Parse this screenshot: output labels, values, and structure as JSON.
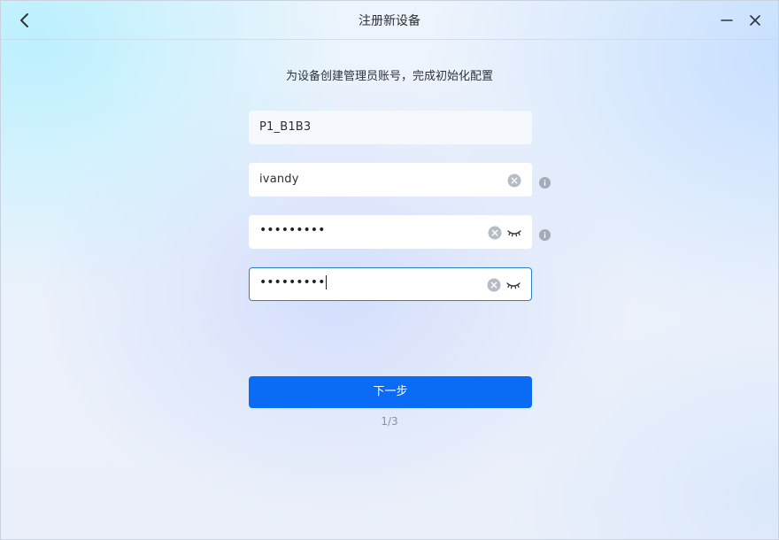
{
  "window": {
    "title": "注册新设备",
    "subtitle": "为设备创建管理员账号，完成初始化配置"
  },
  "icons": {
    "back": "chevron-left-icon",
    "minimize": "minimize-icon",
    "close": "close-icon",
    "clear": "clear-circle-icon",
    "eye": "eye-closed-icon",
    "info": "info-icon"
  },
  "form": {
    "device_name": {
      "value": "P1_B1B3"
    },
    "username": {
      "value": "ivandy"
    },
    "password": {
      "masked_value": "•••••••••"
    },
    "confirm_password": {
      "masked_value": "•••••••••"
    }
  },
  "actions": {
    "next_label": "下一步"
  },
  "progress": {
    "step_text": "1/3"
  },
  "colors": {
    "primary": "#0a6cf5",
    "focus_border": "#2a7fc8"
  }
}
